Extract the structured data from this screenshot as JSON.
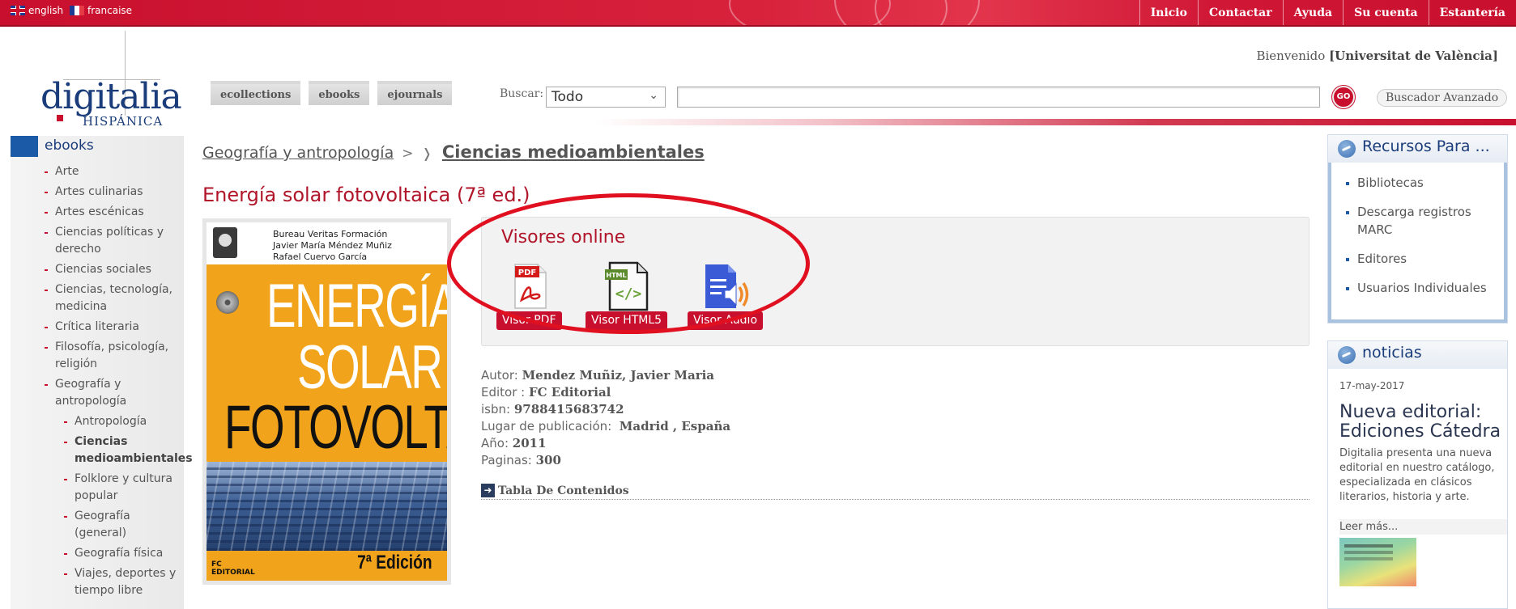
{
  "languages": [
    {
      "label": "english",
      "flag_icon": "uk-flag-icon"
    },
    {
      "label": "francaise",
      "flag_icon": "france-flag-icon"
    }
  ],
  "top_nav": [
    "Inicio",
    "Contactar",
    "Ayuda",
    "Su cuenta",
    "Estantería"
  ],
  "logo": {
    "word": "digitalia",
    "sub": "HISPÁNICA"
  },
  "welcome": {
    "prefix": "Bienvenido",
    "institution": "[Universitat de València]"
  },
  "collection_tabs": [
    "ecollections",
    "ebooks",
    "ejournals"
  ],
  "search": {
    "label": "Buscar:",
    "scope_selected": "Todo",
    "query_value": "",
    "go_label": "GO",
    "advanced_label": "Buscador Avanzado"
  },
  "sidebar": {
    "title": "ebooks",
    "items": [
      {
        "label": "Arte"
      },
      {
        "label": "Artes culinarias"
      },
      {
        "label": "Artes escénicas"
      },
      {
        "label": "Ciencias políticas y derecho"
      },
      {
        "label": "Ciencias sociales"
      },
      {
        "label": "Ciencias, tecnología, medicina"
      },
      {
        "label": "Crítica literaria"
      },
      {
        "label": "Filosofía, psicología, religión"
      },
      {
        "label": "Geografía y antropología"
      }
    ],
    "subitems": [
      {
        "label": "Antropología"
      },
      {
        "label": "Ciencias medioambientales"
      },
      {
        "label": "Folklore y cultura popular"
      },
      {
        "label": "Geografía (general)"
      },
      {
        "label": "Geografía física"
      },
      {
        "label": "Viajes, deportes y tiempo libre"
      }
    ]
  },
  "breadcrumb": {
    "parent": "Geografía y antropología",
    "sep": ">",
    "sep2": "❭",
    "current": "Ciencias medioambientales"
  },
  "book": {
    "title": "Energía solar fotovoltaica (7ª ed.)",
    "cover": {
      "authors": [
        "Bureau Veritas Formación",
        "Javier María Méndez Muñiz",
        "Rafael Cuervo García"
      ],
      "word1": "ENERGÍA",
      "word2": "SOLAR",
      "word3": "FOTOVOLTAICA",
      "edition": "7ª Edición",
      "publisher_line1": "FC",
      "publisher_line2": "EDITORIAL"
    }
  },
  "viewers": {
    "title": "Visores online",
    "items": [
      {
        "label": "Visor PDF",
        "icon": "pdf-icon"
      },
      {
        "label": "Visor HTML5",
        "icon": "html-icon"
      },
      {
        "label": "Visor Audio",
        "icon": "audio-icon"
      }
    ]
  },
  "metadata": {
    "autor_label": "Autor:",
    "autor": "Mendez Muñiz, Javier Maria",
    "editor_label": "Editor :",
    "editor": "FC Editorial",
    "isbn_label": "isbn:",
    "isbn": "9788415683742",
    "lugar_label": "Lugar de publicación:",
    "lugar": "Madrid , España",
    "anio_label": "Año:",
    "anio": "2011",
    "paginas_label": "Paginas:",
    "paginas": "300"
  },
  "toc": {
    "label": "Tabla De Contenidos",
    "icon": "arrow-right-icon"
  },
  "recursos": {
    "title": "Recursos Para ...",
    "items": [
      "Bibliotecas",
      "Descarga registros MARC",
      "Editores",
      "Usuarios Individuales"
    ]
  },
  "noticias": {
    "title": "noticias",
    "date": "17-may-2017",
    "headline": "Nueva editorial: Ediciones Cátedra",
    "text": "Digitalia presenta una nueva editorial en nuestro catálogo, especializada en clásicos literarios, historia y arte.",
    "more": "Leer más..."
  },
  "colors": {
    "brand_red": "#c8102e",
    "title_red": "#b0152a",
    "navy": "#1a3c7a",
    "highlight_ellipse": "#e01020"
  }
}
